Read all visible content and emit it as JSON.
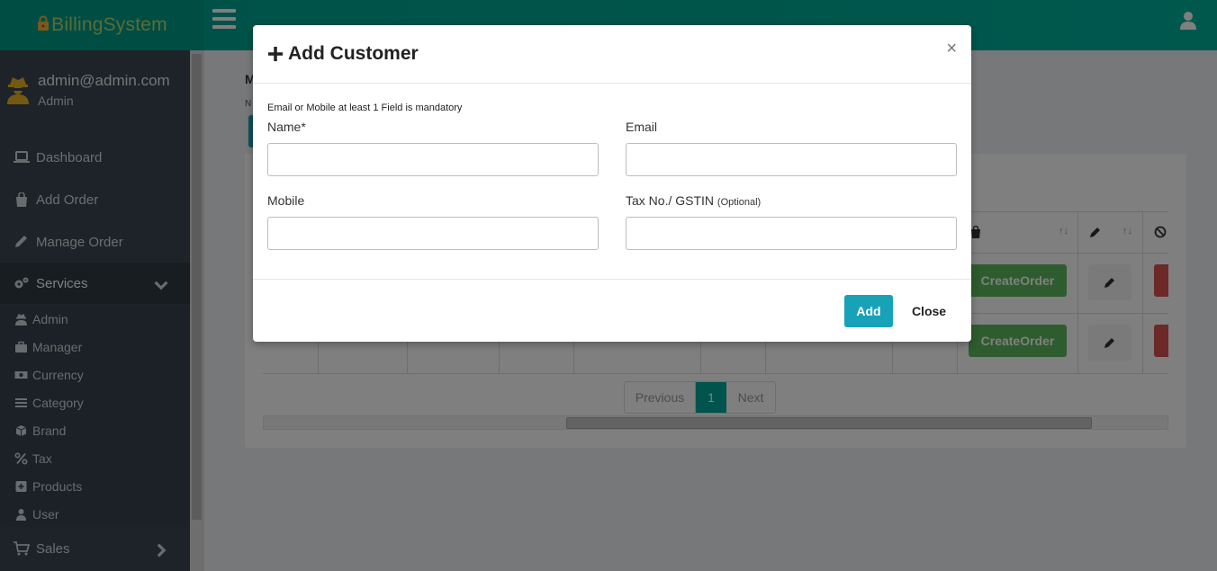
{
  "header": {
    "brand": "BillingSystem"
  },
  "sidebar": {
    "user_email": "admin@admin.com",
    "user_role": "Admin",
    "items": [
      {
        "label": "Dashboard",
        "icon": "laptop-icon"
      },
      {
        "label": "Add Order",
        "icon": "shopping-bag-icon"
      },
      {
        "label": "Manage Order",
        "icon": "pencil-icon"
      },
      {
        "label": "Services",
        "icon": "gears-icon"
      },
      {
        "label": "Sales",
        "icon": "cart-icon"
      }
    ],
    "sub_items": [
      {
        "label": "Admin",
        "icon": "user-secret-icon"
      },
      {
        "label": "Manager",
        "icon": "briefcase-icon"
      },
      {
        "label": "Currency",
        "icon": "money-icon"
      },
      {
        "label": "Category",
        "icon": "list-icon"
      },
      {
        "label": "Brand",
        "icon": "cube-icon"
      },
      {
        "label": "Tax",
        "icon": "percent-icon"
      },
      {
        "label": "Products",
        "icon": "plus-square-icon"
      },
      {
        "label": "User",
        "icon": "user-icon"
      }
    ]
  },
  "background": {
    "heading": "M",
    "subtext": "N",
    "create_order_label": "CreateOrder",
    "pagination": {
      "previous": "Previous",
      "page": "1",
      "next": "Next"
    }
  },
  "modal": {
    "title": "Add Customer",
    "close_symbol": "×",
    "note": "Email or Mobile at least 1 Field is mandatory",
    "fields": {
      "name_label": "Name*",
      "email_label": "Email",
      "mobile_label": "Mobile",
      "tax_label": "Tax No./ GSTIN",
      "tax_label_hint": "(Optional)",
      "name_value": "",
      "email_value": "",
      "mobile_value": "",
      "tax_value": ""
    },
    "add_label": "Add",
    "close_label": "Close"
  },
  "colors": {
    "header_teal": "#00a896",
    "sidebar_dark": "#3a4650",
    "add_button": "#17a2b8",
    "create_order_green": "#5cb85c",
    "delete_red": "#d9534f"
  }
}
